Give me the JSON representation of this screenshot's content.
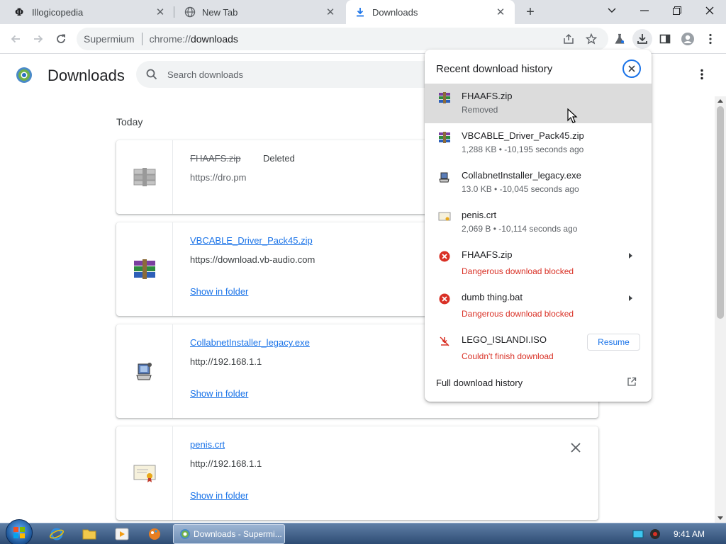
{
  "tabs": [
    {
      "title": "Illogicopedia",
      "icon": "illogicopedia-icon"
    },
    {
      "title": "New Tab",
      "icon": "globe-icon"
    },
    {
      "title": "Downloads",
      "icon": "download-icon",
      "active": true
    }
  ],
  "omnibox": {
    "chip": "Supermium",
    "url_scheme": "chrome://",
    "url_host": "downloads"
  },
  "page": {
    "title": "Downloads",
    "search_placeholder": "Search downloads",
    "section": "Today"
  },
  "downloads": [
    {
      "name": "FHAAFS.zip",
      "status": "Deleted",
      "url": "https://dro.pm",
      "icon": "archive-icon"
    },
    {
      "name": "VBCABLE_Driver_Pack45.zip",
      "url": "https://download.vb-audio.com",
      "action": "Show in folder",
      "icon": "winrar-icon"
    },
    {
      "name": "CollabnetInstaller_legacy.exe",
      "url": "http://192.168.1.1",
      "action": "Show in folder",
      "icon": "installer-icon"
    },
    {
      "name": "penis.crt",
      "url": "http://192.168.1.1",
      "action": "Show in folder",
      "icon": "certificate-icon"
    }
  ],
  "bubble": {
    "title": "Recent download history",
    "items": [
      {
        "name": "FHAAFS.zip",
        "sub": "Removed",
        "icon": "winrar-icon"
      },
      {
        "name": "VBCABLE_Driver_Pack45.zip",
        "sub": "1,288 KB • -10,195 seconds ago",
        "icon": "winrar-icon"
      },
      {
        "name": "CollabnetInstaller_legacy.exe",
        "sub": "13.0 KB • -10,045 seconds ago",
        "icon": "installer-icon"
      },
      {
        "name": "penis.crt",
        "sub": "2,069 B • -10,114 seconds ago",
        "icon": "certificate-icon"
      },
      {
        "name": "FHAAFS.zip",
        "sub": "Dangerous download blocked",
        "icon": "danger-icon"
      },
      {
        "name": "dumb thing.bat",
        "sub": "Dangerous download blocked",
        "icon": "danger-icon"
      },
      {
        "name": "LEGO_ISLANDI.ISO",
        "sub": "Couldn't finish download",
        "icon": "failed-download-icon"
      }
    ],
    "resume_label": "Resume",
    "full_history": "Full download history"
  },
  "taskbar": {
    "active_task": "Downloads - Supermi...",
    "clock": "9:41 AM"
  },
  "colors": {
    "accent": "#1a73e8",
    "danger": "#d93025",
    "tabstrip": "#dee1e6"
  }
}
